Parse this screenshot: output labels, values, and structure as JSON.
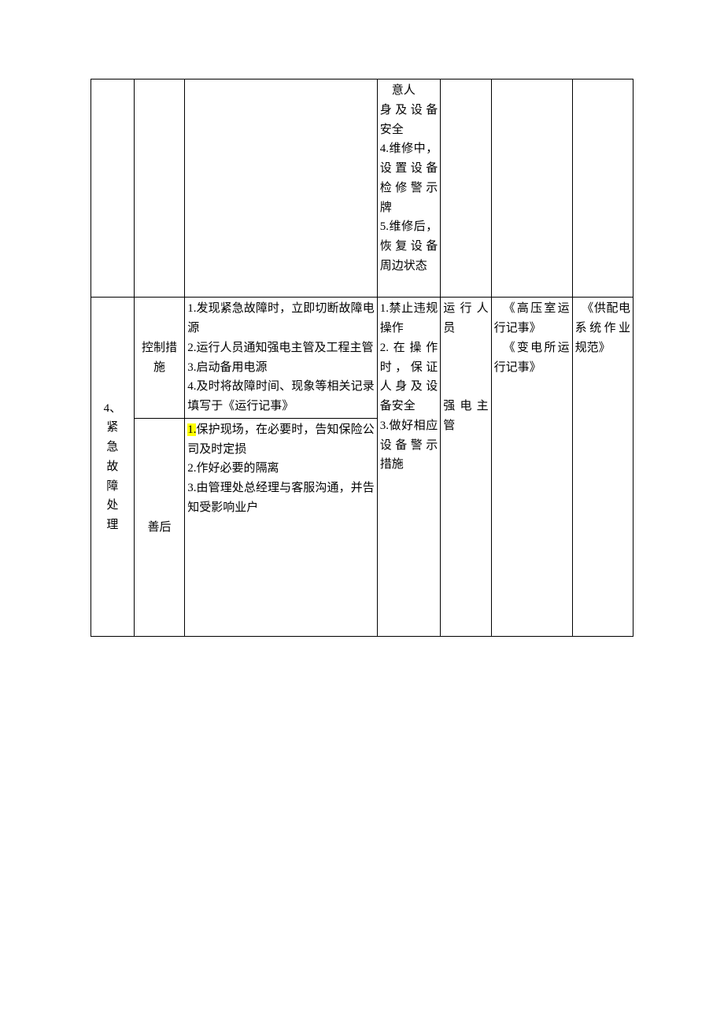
{
  "row1": {
    "col4": "意人身及设备安全\n4.维修中，设置设备检修警示牌\n5.维修后，恢复设备周边状态"
  },
  "row2": {
    "col1_num": "4、",
    "col1_text": "紧急故障处理",
    "sub_a": "控制措施",
    "detail_a": "1.发现紧急故障时，立即切断故障电源\n2.运行人员通知强电主管及工程主管\n3.启动备用电源\n4.及时将故障时间、现象等相关记录填写于《运行记事》",
    "sub_b": "善后",
    "detail_b_prefix": "1.",
    "detail_b_rest": "保护现场，在必要时，告知保险公司及时定损\n2.作好必要的隔离\n3.由管理处总经理与客服沟通，并告知受影响业户",
    "col4": "1.禁止违规操作\n2.在操作时，保证人身及设备安全\n3.做好相应设备警示措施",
    "col5_a": "运行人员",
    "col5_b": "强电主管",
    "col6_a": "《高压室运行记事》",
    "col6_b": "《变电所运行记事》",
    "col7": "《供配电系统作业规范》"
  }
}
